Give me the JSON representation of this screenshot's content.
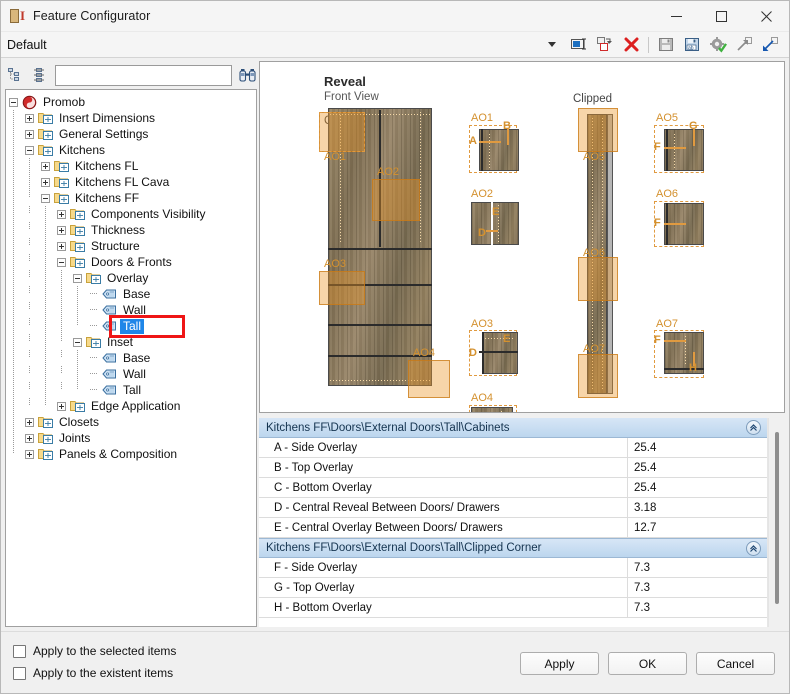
{
  "window": {
    "title": "Feature Configurator",
    "icon": "feature-configurator-icon",
    "minimize": "–",
    "maximize": "□",
    "close": "✕"
  },
  "profile": {
    "selected": "Default",
    "caret": "▾"
  },
  "toolbar": {
    "buttons": [
      {
        "name": "rename-icon",
        "tip": "Rename"
      },
      {
        "name": "duplicate-icon",
        "tip": "Duplicate"
      },
      {
        "name": "delete-icon",
        "tip": "Delete"
      },
      {
        "name": "save-icon",
        "tip": "Save"
      },
      {
        "name": "save-as-icon",
        "tip": "Save As"
      },
      {
        "name": "apply-settings-icon",
        "tip": "Apply Settings"
      },
      {
        "name": "export-icon",
        "tip": "Export"
      },
      {
        "name": "import-icon",
        "tip": "Import"
      }
    ]
  },
  "find": {
    "collapse_all_icon": "collapse-all-icon",
    "expand_all_icon": "expand-all-icon",
    "value": "",
    "placeholder": "",
    "search_icon": "binoculars-search-icon"
  },
  "tree": {
    "nodes": [
      {
        "label": "Promob",
        "depth": 0,
        "state": "minus",
        "icon": "promob-root-icon",
        "selected": false
      },
      {
        "label": "Insert Dimensions",
        "depth": 1,
        "state": "plus",
        "icon": "folder-icon",
        "selected": false
      },
      {
        "label": "General Settings",
        "depth": 1,
        "state": "plus",
        "icon": "folder-icon",
        "selected": false
      },
      {
        "label": "Kitchens",
        "depth": 1,
        "state": "minus",
        "icon": "folder-icon",
        "selected": false
      },
      {
        "label": "Kitchens FL",
        "depth": 2,
        "state": "plus",
        "icon": "folder-icon",
        "selected": false
      },
      {
        "label": "Kitchens FL Cava",
        "depth": 2,
        "state": "plus",
        "icon": "folder-icon",
        "selected": false
      },
      {
        "label": "Kitchens FF",
        "depth": 2,
        "state": "minus",
        "icon": "folder-icon",
        "selected": false
      },
      {
        "label": "Components Visibility",
        "depth": 3,
        "state": "plus",
        "icon": "folder-icon",
        "selected": false
      },
      {
        "label": "Thickness",
        "depth": 3,
        "state": "plus",
        "icon": "folder-icon",
        "selected": false
      },
      {
        "label": "Structure",
        "depth": 3,
        "state": "plus",
        "icon": "folder-icon",
        "selected": false
      },
      {
        "label": "Doors & Fronts",
        "depth": 3,
        "state": "minus",
        "icon": "folder-icon",
        "selected": false
      },
      {
        "label": "Overlay",
        "depth": 4,
        "state": "minus",
        "icon": "folder-icon",
        "selected": false
      },
      {
        "label": "Base",
        "depth": 5,
        "state": "leaf",
        "icon": "tag-icon",
        "selected": false
      },
      {
        "label": "Wall",
        "depth": 5,
        "state": "leaf",
        "icon": "tag-icon",
        "selected": false
      },
      {
        "label": "Tall",
        "depth": 5,
        "state": "leaf",
        "icon": "tag-icon",
        "selected": true
      },
      {
        "label": "Inset",
        "depth": 4,
        "state": "minus",
        "icon": "folder-icon",
        "selected": false
      },
      {
        "label": "Base",
        "depth": 5,
        "state": "leaf",
        "icon": "tag-icon",
        "selected": false
      },
      {
        "label": "Wall",
        "depth": 5,
        "state": "leaf",
        "icon": "tag-icon",
        "selected": false
      },
      {
        "label": "Tall",
        "depth": 5,
        "state": "leaf",
        "icon": "tag-icon",
        "selected": false
      },
      {
        "label": "Edge Application",
        "depth": 3,
        "state": "plus",
        "icon": "folder-icon",
        "selected": false
      },
      {
        "label": "Closets",
        "depth": 1,
        "state": "plus",
        "icon": "folder-icon",
        "selected": false
      },
      {
        "label": "Joints",
        "depth": 1,
        "state": "plus",
        "icon": "folder-icon",
        "selected": false
      },
      {
        "label": "Panels & Composition",
        "depth": 1,
        "state": "plus",
        "icon": "folder-icon",
        "selected": false
      }
    ]
  },
  "preview": {
    "title": "Reveal",
    "subtitle": "Front View",
    "section_cabinets": "Cabinets",
    "section_clipped": "Clipped",
    "callouts": [
      "AO1",
      "AO2",
      "AO3",
      "AO4",
      "AO5",
      "AO6",
      "AO7"
    ],
    "dimension_letters": [
      "A",
      "B",
      "C",
      "D",
      "E",
      "F",
      "G",
      "H"
    ],
    "accent_color": "#e09a40"
  },
  "grid": {
    "groups": [
      {
        "header": "Kitchens FF\\Doors\\External Doors\\Tall\\Cabinets",
        "collapse_icon": "«",
        "rows": [
          {
            "name": "A - Side Overlay",
            "value": "25.4"
          },
          {
            "name": "B - Top Overlay",
            "value": "25.4"
          },
          {
            "name": "C - Bottom Overlay",
            "value": "25.4"
          },
          {
            "name": "D - Central Reveal Between Doors/ Drawers",
            "value": "3.18"
          },
          {
            "name": "E - Central Overlay Between Doors/ Drawers",
            "value": "12.7"
          }
        ]
      },
      {
        "header": "Kitchens FF\\Doors\\External Doors\\Tall\\Clipped Corner",
        "collapse_icon": "«",
        "rows": [
          {
            "name": "F - Side Overlay",
            "value": "7.3"
          },
          {
            "name": "G - Top Overlay",
            "value": "7.3"
          },
          {
            "name": "H - Bottom Overlay",
            "value": "7.3"
          }
        ]
      }
    ]
  },
  "footer": {
    "checkboxes": [
      {
        "label": "Apply to the selected items",
        "checked": false
      },
      {
        "label": "Apply to the existent items",
        "checked": false
      }
    ],
    "buttons": [
      {
        "label": "Apply",
        "name": "apply-button"
      },
      {
        "label": "OK",
        "name": "ok-button"
      },
      {
        "label": "Cancel",
        "name": "cancel-button"
      }
    ]
  }
}
